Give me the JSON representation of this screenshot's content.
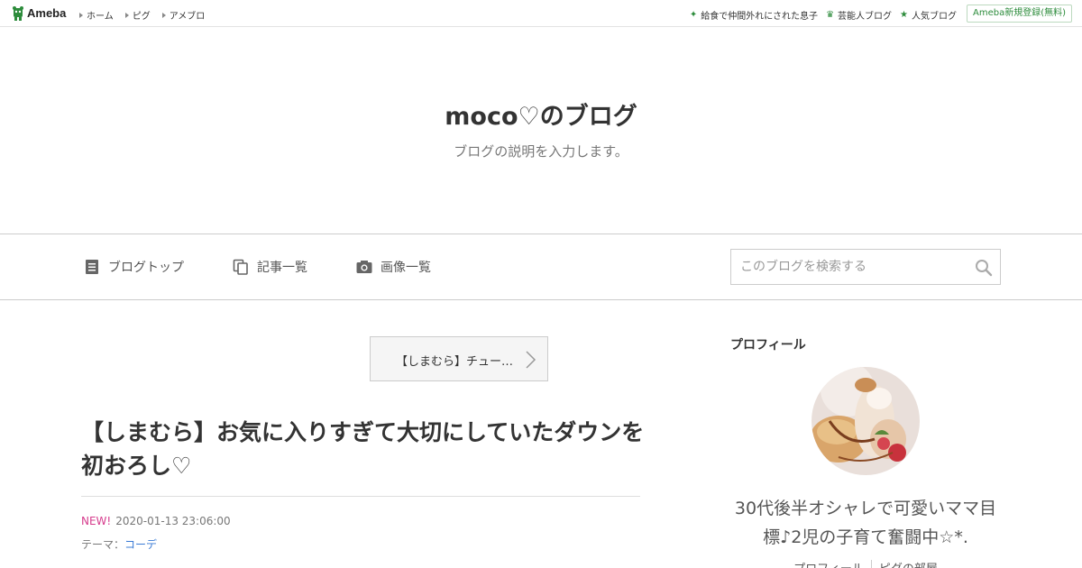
{
  "global_bar": {
    "logo_text": "Ameba",
    "nav": [
      "ホーム",
      "ピグ",
      "アメブロ"
    ],
    "right_links": [
      {
        "icon": "sparkle-icon",
        "label": "給食で仲間外れにされた息子"
      },
      {
        "icon": "crown-icon",
        "label": "芸能人ブログ"
      },
      {
        "icon": "star-icon",
        "label": "人気ブログ"
      }
    ],
    "register_label": "Ameba新規登録(無料)"
  },
  "header": {
    "title": "moco♡のブログ",
    "description": "ブログの説明を入力します。"
  },
  "blog_nav": {
    "items": [
      {
        "icon": "document-icon",
        "label": "ブログトップ"
      },
      {
        "icon": "copy-icon",
        "label": "記事一覧"
      },
      {
        "icon": "camera-icon",
        "label": "画像一覧"
      }
    ],
    "search_placeholder": "このブログを検索する"
  },
  "entry": {
    "next_label": "【しまむら】チュー…",
    "title": "【しまむら】お気に入りすぎて大切にしていたダウンを初おろし♡",
    "new_badge": "NEW!",
    "date": "2020-01-13 23:06:00",
    "theme_prefix": "テーマ：",
    "theme": "コーデ"
  },
  "sidebar": {
    "heading": "プロフィール",
    "profile_text": "30代後半オシャレで可愛いママ目標♪2児の子育て奮闘中☆*.",
    "links": [
      "プロフィール",
      "ピグの部屋"
    ]
  },
  "colors": {
    "ameba_green": "#2d8c3c",
    "new_pink": "#d63c8d",
    "link_blue": "#3a7bd5"
  }
}
